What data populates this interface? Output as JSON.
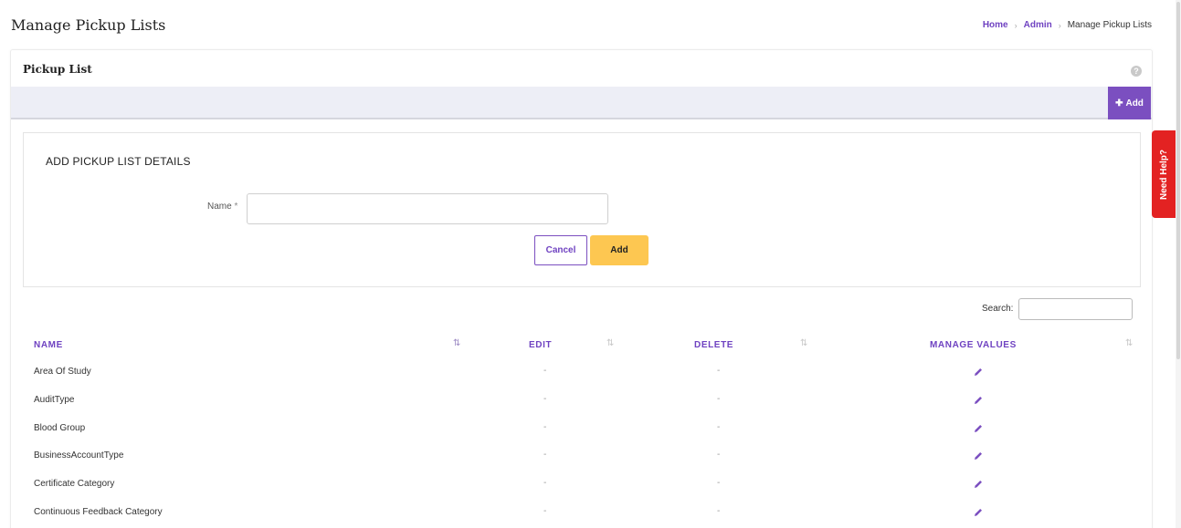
{
  "page": {
    "title": "Manage Pickup Lists"
  },
  "breadcrumb": {
    "home": "Home",
    "admin": "Admin",
    "current": "Manage Pickup Lists",
    "separator": "›"
  },
  "card": {
    "title": "Pickup List",
    "help_icon": "question-circle-icon",
    "help_glyph": "?"
  },
  "toolbar": {
    "add_label": "Add",
    "add_icon": "plus-icon",
    "add_glyph": "✚"
  },
  "form": {
    "heading": "ADD PICKUP LIST DETAILS",
    "name_label": "Name",
    "required_mark": "*",
    "name_value": "",
    "cancel_label": "Cancel",
    "add_label": "Add"
  },
  "search": {
    "label": "Search:",
    "value": ""
  },
  "table": {
    "columns": [
      {
        "label": "NAME",
        "sort": "sorted-ascending"
      },
      {
        "label": "EDIT",
        "sort": "unsorted"
      },
      {
        "label": "DELETE",
        "sort": "unsorted"
      },
      {
        "label": "MANAGE VALUES",
        "sort": "unsorted"
      }
    ],
    "sort_glyph_active": "⇅",
    "sort_glyph": "⇅",
    "dash": "-",
    "manage_icon": "pencil-icon",
    "rows": [
      {
        "name": "Area Of Study",
        "edit": "-",
        "delete": "-"
      },
      {
        "name": "AuditType",
        "edit": "-",
        "delete": "-"
      },
      {
        "name": "Blood Group",
        "edit": "-",
        "delete": "-"
      },
      {
        "name": "BusinessAccountType",
        "edit": "-",
        "delete": "-"
      },
      {
        "name": "Certificate Category",
        "edit": "-",
        "delete": "-"
      },
      {
        "name": "Continuous Feedback Category",
        "edit": "-",
        "delete": "-"
      }
    ]
  },
  "help_tab": {
    "label": "Need Help?"
  },
  "colors": {
    "accent": "#6f42c1",
    "add_button": "#7b4fc0",
    "primary_button": "#fdc751",
    "help_tab": "#e32222",
    "toolbar_band": "#edeef6"
  }
}
